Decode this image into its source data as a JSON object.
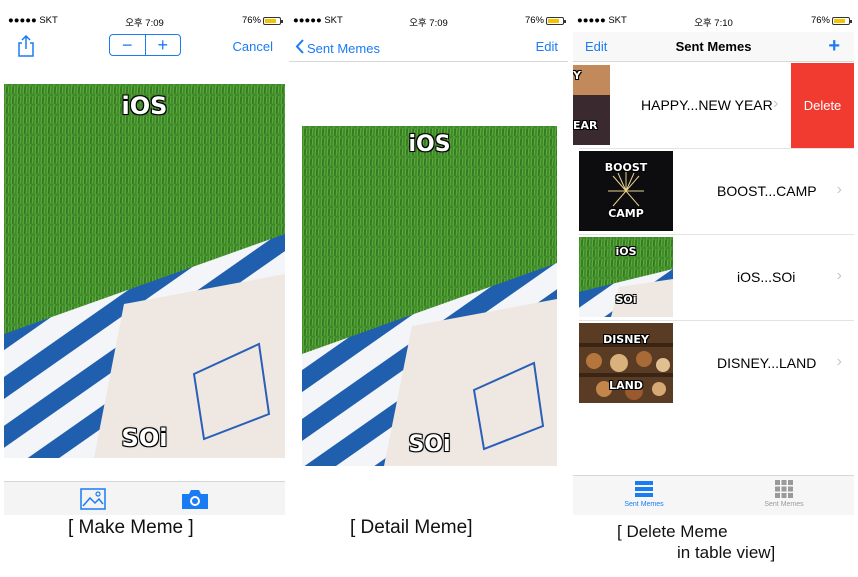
{
  "status_bar": {
    "carrier": "●●●●● SKT",
    "screens": [
      {
        "time": "오후 7:09",
        "battery": "76%"
      },
      {
        "time": "오후 7:09",
        "battery": "76%"
      },
      {
        "time": "오후 7:10",
        "battery": "76%"
      }
    ]
  },
  "make_meme": {
    "nav": {
      "share_icon": "share-icon",
      "stepper_minus": "−",
      "stepper_plus": "+",
      "cancel": "Cancel"
    },
    "top_text": "iOS",
    "bottom_text": "SOi",
    "toolbar": {
      "album_icon": "photo-album-icon",
      "camera_icon": "camera-icon"
    },
    "caption": "[ Make Meme ]"
  },
  "detail_meme": {
    "nav": {
      "back": "Sent Memes",
      "edit": "Edit"
    },
    "top_text": "iOS",
    "bottom_text": "SOi",
    "caption": "[ Detail Meme]"
  },
  "delete_meme": {
    "nav": {
      "edit": "Edit",
      "title": "Sent Memes",
      "add": "+"
    },
    "rows": [
      {
        "thumb_top": "Y",
        "thumb_bottom": "EAR",
        "label": "HAPPY...NEW YEAR"
      },
      {
        "thumb_top": "BOOST",
        "thumb_bottom": "CAMP",
        "label": "BOOST...CAMP"
      },
      {
        "thumb_top": "iOS",
        "thumb_bottom": "SOi",
        "label": "iOS...SOi"
      },
      {
        "thumb_top": "DISNEY",
        "thumb_bottom": "LAND",
        "label": "DISNEY...LAND"
      }
    ],
    "delete_label": "Delete",
    "tabs": [
      {
        "label": "Sent Memes",
        "icon": "list-icon",
        "active": true
      },
      {
        "label": "Sent Memes",
        "icon": "grid-icon",
        "active": false
      }
    ],
    "caption_line1": "[ Delete Meme",
    "caption_line2": "in table view]"
  },
  "colors": {
    "accent": "#1a7cf5",
    "delete": "#f23b30",
    "battery": "#f5c400"
  }
}
